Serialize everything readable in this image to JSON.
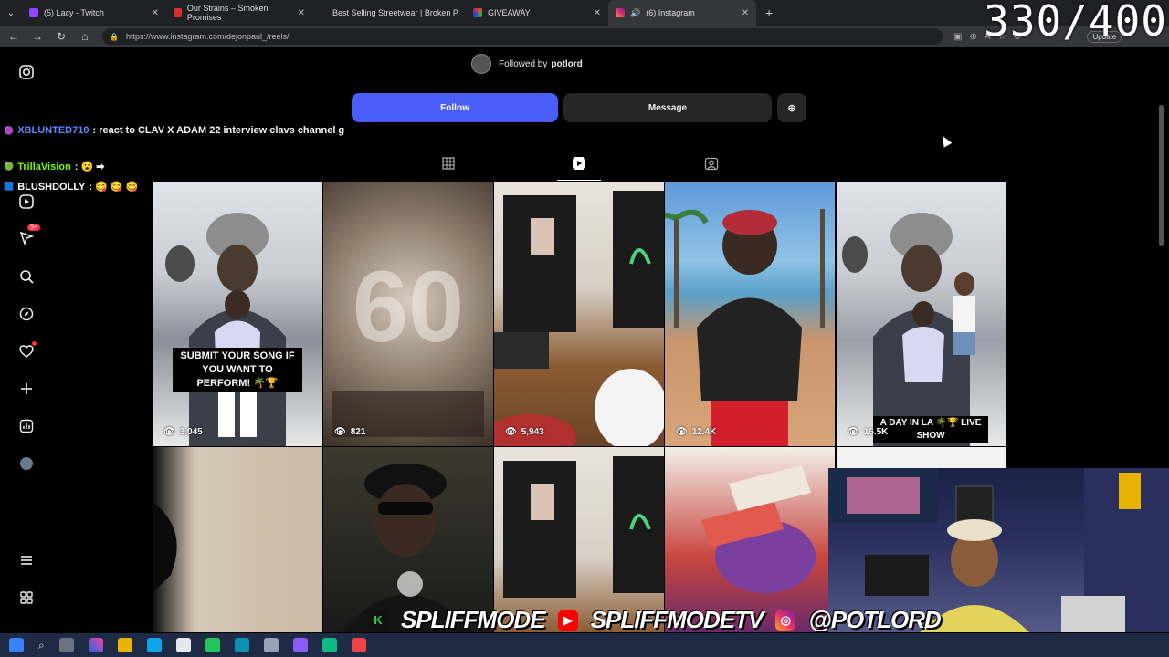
{
  "browser": {
    "tabs": [
      {
        "label": "(5) Lacy - Twitch",
        "favicon_color": "#9146ff",
        "active": false
      },
      {
        "label": "Our Strains – Smoken Promises",
        "favicon_color": "#d32f2f",
        "active": false
      },
      {
        "label": "Best Selling Streetwear | Broken P",
        "favicon_color": "#444444",
        "active": false
      },
      {
        "label": "GIVEAWAY",
        "favicon_color": "#e0e0e0",
        "active": false
      },
      {
        "label": "(6) Instagram",
        "favicon_color": "#e1306c",
        "active": true
      }
    ],
    "url": "https://www.instagram.com/dejonpaul_/reels/",
    "update_label": "Update"
  },
  "stream_counter": "330/400",
  "profile": {
    "followed_by_prefix": "Followed by",
    "followed_by_user": "potlord",
    "follow_label": "Follow",
    "message_label": "Message"
  },
  "sidebar_icons": [
    "instagram-icon",
    "reels-icon",
    "messages-icon",
    "search-icon",
    "explore-icon",
    "notifications-icon",
    "create-icon",
    "dashboard-icon",
    "profile-icon",
    "menu-icon",
    "more-icon"
  ],
  "notifications_badge": "9+",
  "chat": [
    {
      "user": "XBLUNTED710",
      "user_color": "#5b8cff",
      "message": ": react to CLAV X ADAM 22 interview clavs channel g"
    },
    {
      "user": "TrillaVision",
      "user_color": "#7cfc00",
      "message": ": 😮 ➡"
    },
    {
      "user": "BLUSHDOLLY",
      "user_color": "#ffffff",
      "message": ": 😋 😋 😋"
    }
  ],
  "reels": [
    {
      "views": "3,045",
      "caption": "SUBMIT YOUR SONG IF YOU WANT TO PERFORM! 🌴🏆"
    },
    {
      "views": "821",
      "caption": ""
    },
    {
      "views": "5,943",
      "caption": ""
    },
    {
      "views": "12.4K",
      "caption": ""
    },
    {
      "views": "16.5K",
      "caption": "A DAY IN LA 🌴🏆 LIVE SHOW"
    }
  ],
  "promo": {
    "handle1": "SPLIFFMODE",
    "handle2": "SPLIFFMODETV",
    "handle3": "@POTLORD"
  }
}
